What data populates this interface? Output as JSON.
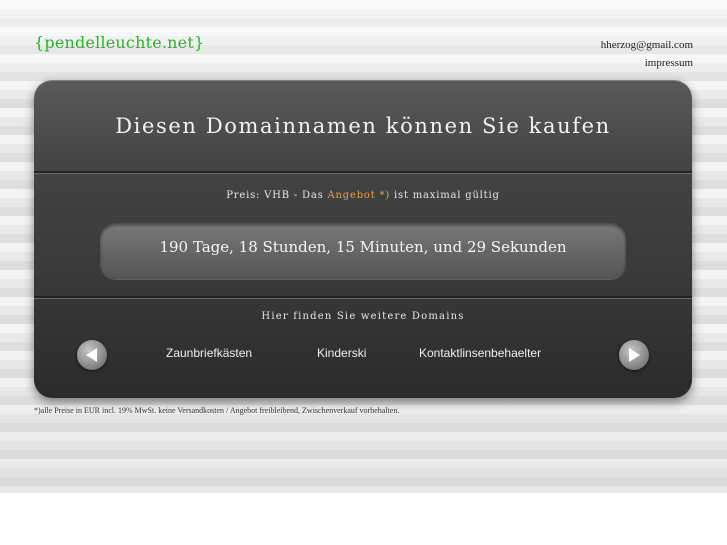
{
  "header": {
    "logo": "{pendelleuchte.net}",
    "email": "hherzog@gmail.com",
    "impressum": "impressum"
  },
  "panel": {
    "title": "Diesen Domainnamen können Sie kaufen",
    "price_prefix": "Preis: VHB - Das ",
    "price_offer": "Angebot *)",
    "price_suffix": " ist maximal gültig",
    "countdown": "190 Tage, 18 Stunden, 15 Minuten, und 29 Sekunden",
    "more_domains_label": "Hier finden Sie weitere Domains",
    "domains": [
      "Zaunbriefkästen",
      "Kinderski",
      "Kontaktlinsenbehaelter"
    ]
  },
  "footnote": "*)alle Preise in EUR incl. 19% MwSt. keine Versandkosten / Angebot freibleibend, Zwischenverkauf vorbehalten.",
  "colors": {
    "logo": "#22b822",
    "offer_highlight": "#f0a040",
    "panel": "#3a3a3a"
  },
  "icons": {
    "prev": "arrow-left-icon",
    "next": "arrow-right-icon"
  }
}
